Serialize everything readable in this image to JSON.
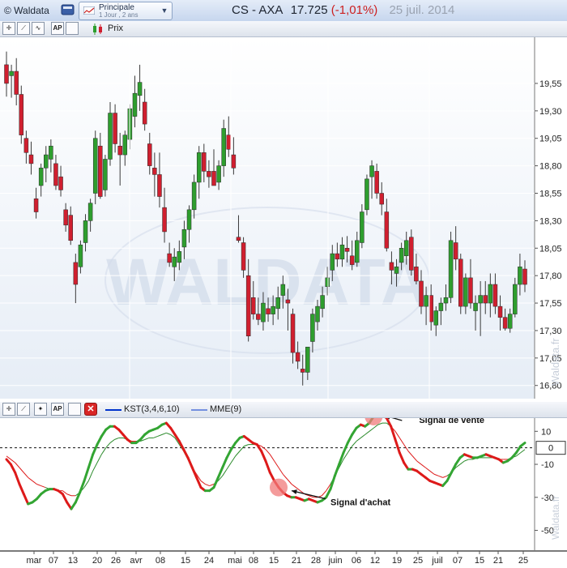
{
  "header": {
    "brand": "© Waldata",
    "selector_name": "Principale",
    "selector_period": "1 Jour , 2 ans",
    "instrument": "CS - AXA",
    "price": "17.725",
    "change": "(-1,01%)",
    "date": "25 juil. 2014"
  },
  "price_toolbar": {
    "legend_label": "Prix"
  },
  "indicator_toolbar": {
    "legend_kst": "KST(3,4,6,10)",
    "legend_mme": "MME(9)"
  },
  "colors": {
    "up": "#2e9e2e",
    "down": "#d01f2f",
    "kst_up": "#33a533",
    "kst_down": "#dd1a1a",
    "mme": "#dd1a1a",
    "mme_green": "#2a8a2a"
  },
  "icons": [
    "crosshair-icon",
    "line-tool-icon",
    "trend-tool-icon",
    "ap-icon",
    "blank-icon",
    "candle-icon",
    "magic-icon",
    "close-red-icon"
  ],
  "watermark": "WALDATA",
  "side_watermark": "Waldata.fr",
  "chart_data": [
    {
      "type": "candlestick",
      "y_ticks": [
        "19,55",
        "19,30",
        "19,05",
        "18,80",
        "18,55",
        "18,30",
        "18,05",
        "17,80",
        "17,55",
        "17,30",
        "17,05",
        "16,80"
      ],
      "ylim": [
        16.68,
        19.97
      ],
      "candles": [
        [
          19.72,
          19.84,
          19.43,
          19.55
        ],
        [
          19.62,
          19.72,
          19.42,
          19.66
        ],
        [
          19.66,
          19.78,
          19.35,
          19.45
        ],
        [
          19.45,
          19.53,
          19.0,
          19.08
        ],
        [
          19.05,
          19.12,
          18.82,
          18.92
        ],
        [
          18.9,
          19.02,
          18.72,
          18.82
        ],
        [
          18.5,
          18.6,
          18.32,
          18.38
        ],
        [
          18.62,
          18.82,
          18.52,
          18.78
        ],
        [
          18.78,
          18.98,
          18.65,
          18.9
        ],
        [
          18.86,
          19.04,
          18.74,
          18.98
        ],
        [
          18.82,
          18.9,
          18.58,
          18.62
        ],
        [
          18.7,
          18.8,
          18.52,
          18.58
        ],
        [
          18.4,
          18.46,
          18.2,
          18.26
        ],
        [
          18.35,
          18.43,
          18.08,
          18.12
        ],
        [
          17.92,
          18.0,
          17.55,
          17.72
        ],
        [
          17.88,
          18.12,
          17.82,
          18.08
        ],
        [
          18.1,
          18.36,
          18.02,
          18.3
        ],
        [
          18.3,
          18.5,
          18.2,
          18.46
        ],
        [
          18.55,
          19.12,
          18.45,
          19.05
        ],
        [
          18.98,
          19.1,
          18.5,
          18.52
        ],
        [
          18.58,
          18.9,
          18.52,
          18.86
        ],
        [
          18.86,
          19.38,
          18.8,
          19.28
        ],
        [
          19.28,
          19.36,
          18.92,
          19.0
        ],
        [
          18.98,
          19.1,
          18.62,
          18.9
        ],
        [
          18.9,
          19.12,
          18.8,
          19.08
        ],
        [
          19.04,
          19.36,
          18.95,
          19.32
        ],
        [
          19.25,
          19.62,
          19.15,
          19.46
        ],
        [
          19.44,
          19.72,
          19.3,
          19.56
        ],
        [
          19.38,
          19.5,
          19.12,
          19.18
        ],
        [
          19.0,
          19.1,
          18.72,
          18.8
        ],
        [
          18.78,
          18.92,
          18.52,
          18.72
        ],
        [
          18.72,
          18.92,
          18.42,
          18.52
        ],
        [
          18.42,
          18.6,
          18.1,
          18.2
        ],
        [
          18.0,
          18.1,
          17.88,
          17.92
        ],
        [
          17.88,
          18.05,
          17.75,
          17.97
        ],
        [
          17.92,
          18.12,
          17.85,
          18.02
        ],
        [
          18.06,
          18.3,
          17.95,
          18.22
        ],
        [
          18.22,
          18.44,
          18.1,
          18.4
        ],
        [
          18.4,
          18.72,
          18.32,
          18.65
        ],
        [
          18.65,
          18.98,
          18.5,
          18.92
        ],
        [
          18.92,
          19.0,
          18.65,
          18.75
        ],
        [
          18.75,
          18.85,
          18.6,
          18.7
        ],
        [
          18.75,
          18.95,
          18.62,
          18.62
        ],
        [
          18.65,
          18.85,
          18.58,
          18.8
        ],
        [
          18.8,
          19.22,
          18.7,
          19.14
        ],
        [
          19.08,
          19.25,
          18.88,
          18.95
        ],
        [
          18.9,
          19.06,
          18.72,
          18.78
        ],
        [
          18.15,
          18.35,
          18.1,
          18.12
        ],
        [
          18.1,
          18.15,
          17.78,
          17.85
        ],
        [
          17.8,
          17.95,
          17.2,
          17.25
        ],
        [
          17.6,
          17.75,
          17.4,
          17.45
        ],
        [
          17.45,
          17.6,
          17.35,
          17.4
        ],
        [
          17.38,
          17.65,
          17.3,
          17.55
        ],
        [
          17.5,
          17.6,
          17.38,
          17.45
        ],
        [
          17.45,
          17.62,
          17.35,
          17.52
        ],
        [
          17.5,
          17.7,
          17.4,
          17.6
        ],
        [
          17.62,
          17.8,
          17.5,
          17.72
        ],
        [
          17.58,
          17.68,
          17.3,
          17.55
        ],
        [
          17.45,
          17.5,
          17.0,
          17.1
        ],
        [
          17.1,
          17.2,
          16.95,
          17.02
        ],
        [
          16.95,
          17.08,
          16.8,
          16.92
        ],
        [
          16.92,
          17.15,
          16.85,
          17.15
        ],
        [
          17.2,
          17.5,
          17.1,
          17.45
        ],
        [
          17.38,
          17.58,
          17.3,
          17.52
        ],
        [
          17.5,
          17.7,
          17.42,
          17.62
        ],
        [
          17.7,
          17.88,
          17.62,
          17.78
        ],
        [
          17.85,
          18.08,
          17.75,
          18.0
        ],
        [
          18.0,
          18.1,
          17.88,
          17.95
        ],
        [
          17.95,
          18.15,
          17.88,
          18.08
        ],
        [
          18.05,
          18.16,
          17.92,
          18.02
        ],
        [
          17.98,
          18.12,
          17.85,
          17.9
        ],
        [
          17.92,
          18.2,
          17.88,
          18.12
        ],
        [
          18.1,
          18.45,
          18.05,
          18.38
        ],
        [
          18.4,
          18.72,
          18.35,
          18.68
        ],
        [
          18.7,
          18.85,
          18.5,
          18.8
        ],
        [
          18.75,
          18.82,
          18.5,
          18.55
        ],
        [
          18.55,
          18.65,
          18.35,
          18.45
        ],
        [
          18.38,
          18.5,
          18.02,
          18.05
        ],
        [
          17.92,
          18.02,
          17.72,
          17.85
        ],
        [
          17.82,
          17.95,
          17.7,
          17.88
        ],
        [
          17.92,
          18.1,
          17.85,
          18.05
        ],
        [
          17.98,
          18.2,
          17.9,
          18.12
        ],
        [
          18.15,
          18.22,
          17.8,
          17.85
        ],
        [
          17.88,
          18.0,
          17.72,
          17.75
        ],
        [
          17.75,
          17.85,
          17.45,
          17.52
        ],
        [
          17.52,
          17.7,
          17.35,
          17.62
        ],
        [
          17.62,
          17.72,
          17.3,
          17.38
        ],
        [
          17.35,
          17.52,
          17.25,
          17.48
        ],
        [
          17.48,
          17.6,
          17.35,
          17.55
        ],
        [
          17.55,
          17.72,
          17.48,
          17.6
        ],
        [
          17.6,
          18.2,
          17.55,
          18.12
        ],
        [
          18.1,
          18.25,
          17.85,
          17.95
        ],
        [
          17.95,
          18.0,
          17.45,
          17.52
        ],
        [
          17.52,
          17.82,
          17.45,
          17.78
        ],
        [
          17.78,
          17.95,
          17.5,
          17.55
        ],
        [
          17.48,
          17.62,
          17.3,
          17.55
        ],
        [
          17.55,
          17.75,
          17.25,
          17.62
        ],
        [
          17.62,
          17.75,
          17.45,
          17.55
        ],
        [
          17.55,
          17.82,
          17.42,
          17.72
        ],
        [
          17.72,
          17.82,
          17.45,
          17.52
        ],
        [
          17.52,
          17.62,
          17.3,
          17.42
        ],
        [
          17.42,
          17.5,
          17.3,
          17.32
        ],
        [
          17.32,
          17.5,
          17.28,
          17.45
        ],
        [
          17.45,
          17.78,
          17.42,
          17.72
        ],
        [
          17.72,
          18.0,
          17.62,
          17.88
        ],
        [
          17.86,
          17.94,
          17.65,
          17.72
        ]
      ]
    },
    {
      "type": "line",
      "series": [
        {
          "name": "KST(3,4,6,10)"
        },
        {
          "name": "MME(9)"
        }
      ],
      "y_ticks": [
        "10",
        "-10",
        "-30",
        "-50"
      ],
      "ylim": [
        -62,
        18
      ],
      "last_value": "0",
      "x_tick_labels": [
        "mar",
        "07",
        "13",
        "20",
        "26",
        "avr",
        "08",
        "15",
        "24",
        "mai",
        "08",
        "15",
        "21",
        "28",
        "juin",
        "06",
        "12",
        "19",
        "25",
        "juil",
        "07",
        "15",
        "21",
        "25"
      ],
      "kst": [
        -7,
        -10,
        -15,
        -22,
        -28,
        -34,
        -33,
        -31,
        -28,
        -26,
        -25,
        -25,
        -26,
        -28,
        -33,
        -37,
        -33,
        -27,
        -20,
        -12,
        -4,
        2,
        7,
        11,
        13,
        13,
        11,
        8,
        5,
        3,
        3,
        5,
        8,
        10,
        11,
        12,
        14,
        15,
        12,
        8,
        4,
        -1,
        -6,
        -12,
        -18,
        -24,
        -26,
        -26,
        -24,
        -18,
        -12,
        -6,
        -1,
        3,
        6,
        7,
        5,
        3,
        2,
        -2,
        -8,
        -15,
        -20,
        -24,
        -27,
        -29,
        -30,
        -30,
        -31,
        -32,
        -31,
        -32,
        -33,
        -32,
        -30,
        -25,
        -17,
        -10,
        -3,
        3,
        8,
        12,
        14,
        13,
        15,
        19,
        20,
        20,
        18,
        13,
        5,
        -3,
        -9,
        -13,
        -13,
        -14,
        -16,
        -18,
        -20,
        -21,
        -22,
        -23,
        -20,
        -15,
        -10,
        -6,
        -4,
        -5,
        -6,
        -6,
        -5,
        -4,
        -5,
        -6,
        -7,
        -9,
        -8,
        -6,
        -3,
        1,
        3
      ],
      "mme": [
        -5,
        -7,
        -9,
        -12,
        -15,
        -18,
        -20,
        -22,
        -23,
        -24,
        -25,
        -25,
        -26,
        -26,
        -28,
        -29,
        -29,
        -27,
        -24,
        -20,
        -14,
        -9,
        -4,
        0,
        3,
        5,
        6,
        6,
        5,
        4,
        4,
        4,
        5,
        6,
        6,
        7,
        8,
        9,
        8,
        6,
        2,
        -2,
        -7,
        -12,
        -16,
        -20,
        -22,
        -23,
        -22,
        -20,
        -17,
        -13,
        -9,
        -5,
        -2,
        1,
        2,
        2,
        2,
        1,
        -1,
        -4,
        -8,
        -12,
        -16,
        -19,
        -22,
        -24,
        -26,
        -28,
        -29,
        -30,
        -30,
        -29,
        -26,
        -22,
        -17,
        -12,
        -7,
        -3,
        1,
        4,
        6,
        8,
        10,
        12,
        14,
        15,
        15,
        13,
        10,
        6,
        2,
        -2,
        -5,
        -8,
        -10,
        -12,
        -14,
        -16,
        -17,
        -18,
        -17,
        -15,
        -12,
        -10,
        -8,
        -7,
        -7,
        -6,
        -6,
        -6,
        -6,
        -6,
        -7,
        -7,
        -7,
        -6,
        -5,
        -3,
        -1
      ],
      "annotations": [
        {
          "text": "Signal de vente"
        },
        {
          "text": "Signal d'achat"
        }
      ]
    }
  ]
}
